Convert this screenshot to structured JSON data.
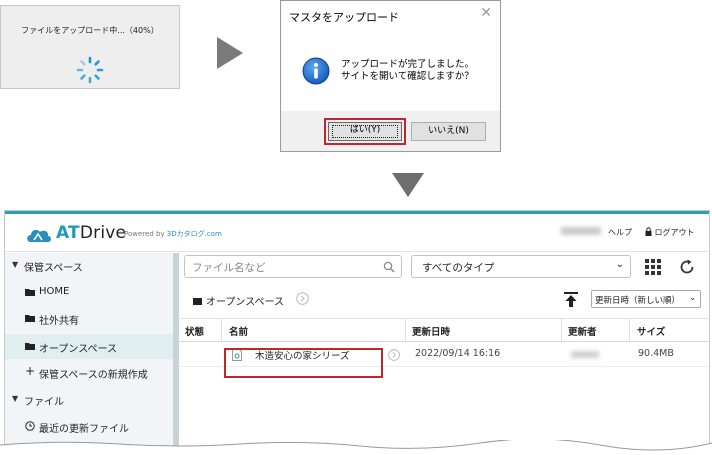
{
  "progress": {
    "text": "ファイルをアップロード中...（40%）",
    "percent": 40,
    "spinner_color": "#1e90d6"
  },
  "dialog": {
    "title": "マスタをアップロード",
    "close_icon": "close-icon",
    "message_line1": "アップロードが完了しました。",
    "message_line2": "サイトを開いて確認しますか？",
    "yes_label": "はい(Y)",
    "no_label": "いいえ(N)",
    "icon": "info-icon",
    "highlight_color": "#c0272d"
  },
  "app": {
    "logo_text_a": "AT",
    "logo_text_b": "Drive",
    "powered_by": "Powered by ",
    "powered_brand": "3Dカタログ.com",
    "help": "ヘルプ",
    "logout": "ログアウト",
    "accent_color": "#2aa0b8",
    "sidebar": {
      "storage_header": "保管スペース",
      "items": [
        {
          "label": "HOME",
          "icon": "folder-icon"
        },
        {
          "label": "社外共有",
          "icon": "folder-icon"
        },
        {
          "label": "オープンスペース",
          "icon": "folder-icon",
          "active": true
        },
        {
          "label": "保管スペースの新規作成",
          "icon": "plus-icon"
        }
      ],
      "file_header": "ファイル",
      "file_items": [
        {
          "label": "最近の更新ファイル",
          "icon": "clock-icon"
        }
      ]
    },
    "toolbar": {
      "search_placeholder": "ファイル名など",
      "type_filter": "すべてのタイプ",
      "sort": "更新日時（新しい順）"
    },
    "breadcrumb": "オープンスペース",
    "table": {
      "headers": [
        "状態",
        "名前",
        "更新日時",
        "更新者",
        "サイズ"
      ],
      "rows": [
        {
          "status": "",
          "name": "木造安心の家シリーズ",
          "updated": "2022/09/14 16:16",
          "size": "90.4MB"
        }
      ]
    }
  }
}
